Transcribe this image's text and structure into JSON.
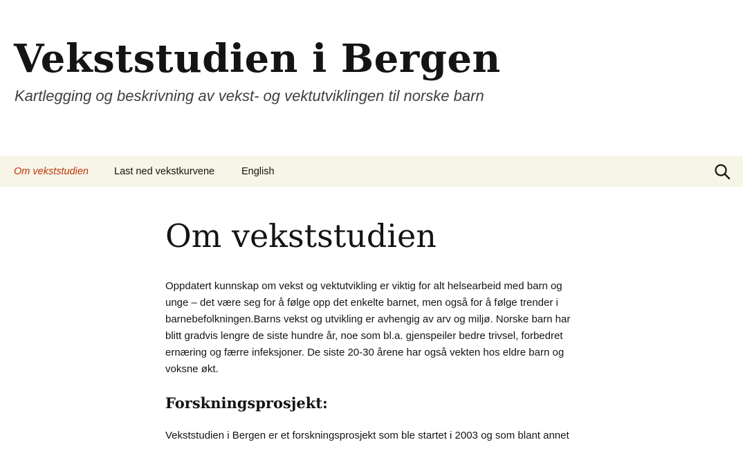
{
  "header": {
    "site_title": "Vekststudien i Bergen",
    "site_description": "Kartlegging og beskrivning av vekst- og vektutviklingen til norske barn"
  },
  "nav": {
    "items": [
      {
        "label": "Om vekststudien",
        "active": true
      },
      {
        "label": "Last ned vekstkurvene",
        "active": false
      },
      {
        "label": "English",
        "active": false
      }
    ],
    "search_icon": "search-icon"
  },
  "main": {
    "title": "Om vekststudien",
    "intro_paragraph": "Oppdatert kunnskap om vekst og vektutvikling er viktig for alt helsearbeid med barn og unge – det være seg for å følge opp det enkelte barnet, men også for å følge trender i barnebefolkningen.Barns vekst og utvikling er avhengig av arv og miljø. Norske barn har blitt gradvis lengre de siste hundre år, noe som bl.a. gjenspeiler bedre trivsel, forbedret ernæring og færre infeksjoner. De siste 20-30 årene har også vekten hos eldre barn og voksne økt.",
    "section_heading": "Forskningsprosjekt:",
    "section_paragraph": "Vekststudien i Bergen er et forskningsprosjekt som ble startet i 2003 og som blant annet"
  },
  "colors": {
    "nav_background": "#f7f5e7",
    "active_link": "#bc360a",
    "text": "#141412"
  }
}
